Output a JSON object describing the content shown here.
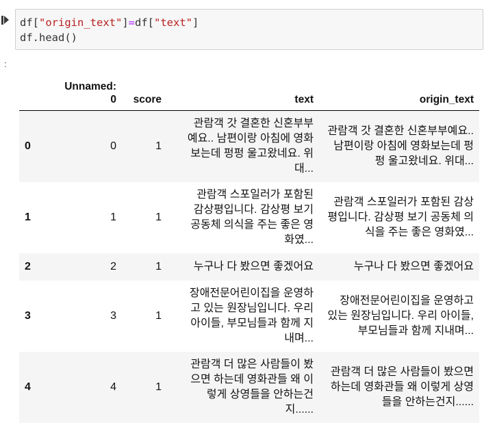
{
  "cell": {
    "code_line1_parts": [
      "df[",
      "\"origin_text\"",
      "]",
      "=",
      "df[",
      "\"text\"",
      "]"
    ],
    "code_line2": "df.head()",
    "output_prompt": ":"
  },
  "table": {
    "columns": [
      "Unnamed: 0",
      "score",
      "text",
      "origin_text"
    ],
    "header_unnamed_line1": "Unnamed:",
    "header_unnamed_line2": "0",
    "rows": [
      {
        "index": "0",
        "unnamed": "0",
        "score": "1",
        "text": [
          "관람객 갓 결혼한 신혼부부",
          "예요.. 남편이랑 아침에 영화",
          "보는데 펑펑 울고왔네요. 위",
          "대..."
        ],
        "origin_text": [
          "관람객 갓 결혼한 신혼부부예요..",
          "남편이랑 아침에 영화보는데 펑",
          "펑 울고왔네요. 위대..."
        ]
      },
      {
        "index": "1",
        "unnamed": "1",
        "score": "1",
        "text": [
          "관람객 스포일러가 포함된",
          "감상평입니다. 감상평 보기",
          "공동체 의식을 주는 좋은 영",
          "화였..."
        ],
        "origin_text": [
          "관람객 스포일러가 포함된 감상",
          "평입니다. 감상평 보기 공동체 의",
          "식을 주는 좋은 영화였..."
        ]
      },
      {
        "index": "2",
        "unnamed": "2",
        "score": "1",
        "text": [
          "누구나 다 봤으면 좋겠어요"
        ],
        "origin_text": [
          "누구나 다 봤으면 좋겠어요"
        ]
      },
      {
        "index": "3",
        "unnamed": "3",
        "score": "1",
        "text": [
          "장애전문어린이집을 운영하",
          "고 있는 원장님입니다. 우리",
          "아이들, 부모님들과 함께 지",
          "내며..."
        ],
        "origin_text": [
          "장애전문어린이집을 운영하고",
          "있는 원장님입니다. 우리 아이들,",
          "부모님들과 함께 지내며..."
        ]
      },
      {
        "index": "4",
        "unnamed": "4",
        "score": "1",
        "text": [
          "관람객 더 많은 사람들이 봤",
          "으면 하는데 영화관들 왜 이",
          "렇게 상영들을 안하는건",
          "지......"
        ],
        "origin_text": [
          "관람객 더 많은 사람들이 봤으면",
          "하는데 영화관들 왜 이렇게 상영",
          "들을 안하는건지......"
        ]
      }
    ]
  }
}
